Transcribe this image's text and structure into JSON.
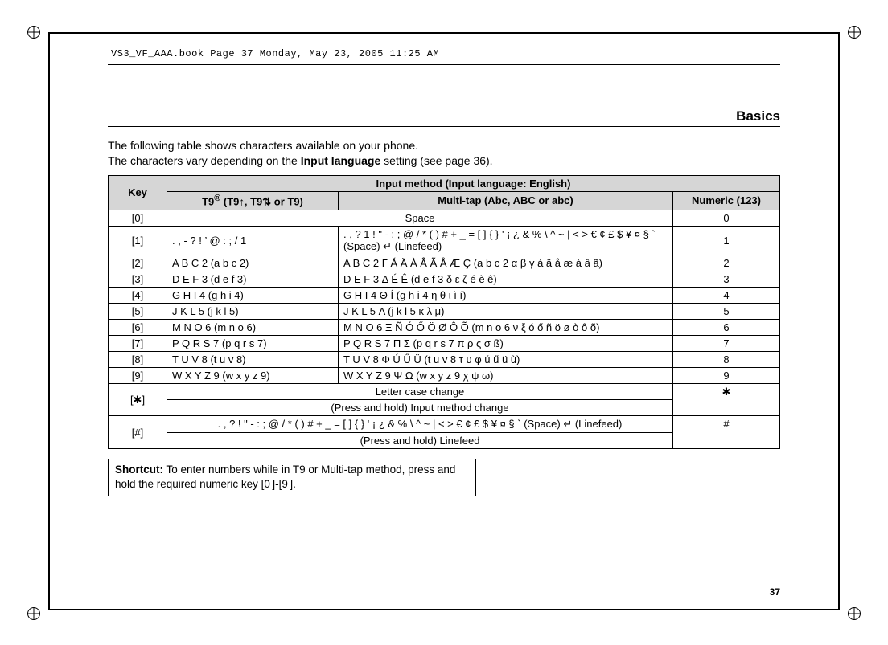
{
  "running_header": "VS3_VF_AAA.book  Page 37  Monday, May 23, 2005  11:25 AM",
  "section_title": "Basics",
  "intro_line1": "The following table shows characters available on your phone.",
  "intro_line2_a": "The characters vary depending on the ",
  "intro_line2_b": "Input language",
  "intro_line2_c": " setting (see page 36).",
  "table": {
    "header_key": "Key",
    "header_method": "Input method (Input language: English)",
    "header_t9_a": "T9",
    "header_t9_sup": "®",
    "header_t9_b": " (T9↑, T9⇅ or T9)",
    "header_multitap": "Multi-tap (Abc, ABC or abc)",
    "header_numeric": "Numeric (123)",
    "rows": [
      {
        "key": "[0]",
        "span_t9_multitap": "Space",
        "numeric": "0"
      },
      {
        "key": "[1]",
        "t9": ". , - ? ! ’ @ : ; / 1",
        "multitap": ". , ? 1 ! \" - : ; @ / * ( ) # + _ = [ ] { } ' ¡ ¿ & % \\ ^ ~ | < > € ¢ £ $ ¥ ¤ § ` (Space) ↵ (Linefeed)",
        "numeric": "1"
      },
      {
        "key": "[2]",
        "t9": "A B C 2 (a b c 2)",
        "multitap": "A B C 2 Γ Á Ä À Â Ã Å Æ Ç (a b c 2 α β γ á ä å æ à â ã)",
        "numeric": "2"
      },
      {
        "key": "[3]",
        "t9": "D E F 3 (d e f 3)",
        "multitap": "D E F 3 Δ É Ê (d e f 3 δ ε ζ é è ê)",
        "numeric": "3"
      },
      {
        "key": "[4]",
        "t9": "G H I 4 (g h i 4)",
        "multitap": "G H I 4 Θ Í (g h i 4 η θ ι ì í)",
        "numeric": "4"
      },
      {
        "key": "[5]",
        "t9": "J K L 5 (j k l 5)",
        "multitap": "J K L 5 Λ (j k l 5 κ λ μ)",
        "numeric": "5"
      },
      {
        "key": "[6]",
        "t9": "M N O 6 (m n o 6)",
        "multitap": "M N O 6 Ξ Ñ Ó Ő Ö Ø Ô Õ (m n o 6 ν ξ ó ő ñ ö ø ò ô õ)",
        "numeric": "6"
      },
      {
        "key": "[7]",
        "t9": "P Q R S 7 (p q r s 7)",
        "multitap": "P Q R S 7 Π Σ (p q r s 7 π ρ ς σ ß)",
        "numeric": "7"
      },
      {
        "key": "[8]",
        "t9": "T U V 8 (t u v 8)",
        "multitap": "T U V 8 Φ Ú Ű Ü (t u v 8 τ υ φ ú ű ü ù)",
        "numeric": "8"
      },
      {
        "key": "[9]",
        "t9": "W X Y Z 9 (w x y z 9)",
        "multitap": "W X Y Z 9 Ψ Ω (w x y z 9 χ ψ ω)",
        "numeric": "9"
      }
    ],
    "star_key": "[✱]",
    "star_row1": "Letter case change",
    "star_num": "✱",
    "star_row2": "(Press and hold) Input method change",
    "hash_key": "[#]",
    "hash_row1": ". , ? ! \" - : ; @ / * ( ) # + _ = [ ] { } ' ¡ ¿ & % \\ ^ ~ | < > € ¢ £ $ ¥ ¤ § ` (Space) ↵ (Linefeed)",
    "hash_num": "#",
    "hash_row2": "(Press and hold) Linefeed"
  },
  "shortcut": {
    "label": "Shortcut:",
    "text_a": "  To enter numbers while in T9 or Multi-tap method, press and hold the required numeric key [",
    "key0": "0",
    "text_b": "]-[",
    "key9": "9",
    "text_c": "]."
  },
  "page_number": "37"
}
